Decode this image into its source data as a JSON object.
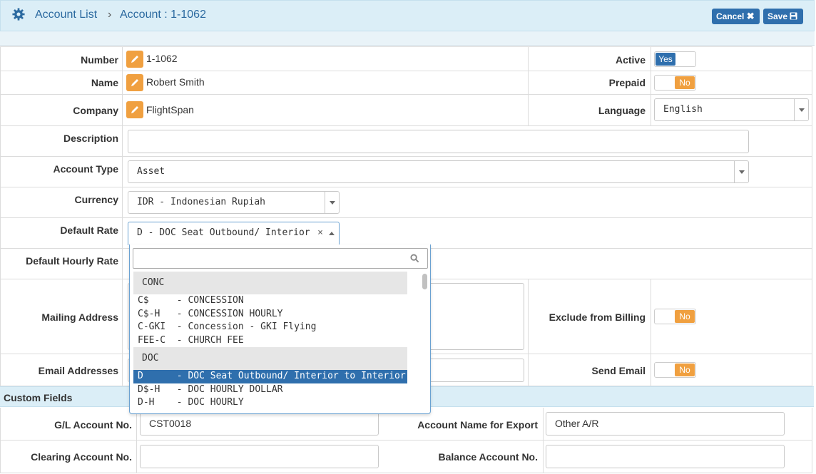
{
  "header": {
    "crumb1": "Account List",
    "separator": "›",
    "crumb2": "Account : 1-1062",
    "cancel_label": "Cancel",
    "save_label": "Save"
  },
  "form": {
    "number_label": "Number",
    "number_value": "1-1062",
    "name_label": "Name",
    "name_value": "Robert Smith",
    "company_label": "Company",
    "company_value": "FlightSpan",
    "active_label": "Active",
    "active_value": "Yes",
    "prepaid_label": "Prepaid",
    "prepaid_value": "No",
    "language_label": "Language",
    "language_value": "English",
    "description_label": "Description",
    "account_type_label": "Account Type",
    "account_type_value": "Asset",
    "currency_label": "Currency",
    "currency_value": "IDR - Indonesian Rupiah",
    "default_rate_label": "Default Rate",
    "default_rate_value": "D - DOC Seat Outbound/ Interior",
    "default_hourly_rate_label": "Default Hourly Rate",
    "mailing_address_label": "Mailing Address",
    "exclude_billing_label": "Exclude from Billing",
    "exclude_billing_value": "No",
    "email_addresses_label": "Email Addresses",
    "send_email_label": "Send Email",
    "send_email_value": "No"
  },
  "custom_fields": {
    "section_title": "Custom Fields",
    "gl_account_label": "G/L Account No.",
    "gl_account_value": "CST0018",
    "export_name_label": "Account Name for Export",
    "export_name_value": "Other A/R",
    "clearing_account_label": "Clearing Account No.",
    "balance_account_label": "Balance Account No."
  },
  "dropdown": {
    "groups": [
      {
        "label": "CONC",
        "items": [
          "C$     - CONCESSION",
          "C$-H   - CONCESSION HOURLY",
          "C-GKI  - Concession - GKI Flying",
          "FEE-C  - CHURCH FEE"
        ]
      },
      {
        "label": "DOC",
        "items": [
          "D      - DOC Seat Outbound/ Interior to Interior",
          "D$-H   - DOC HOURLY DOLLAR",
          "D-H    - DOC HOURLY"
        ]
      }
    ]
  },
  "colors": {
    "accent": "#2f6fad",
    "warning": "#f0a040",
    "header_bg": "#dbeef7"
  }
}
